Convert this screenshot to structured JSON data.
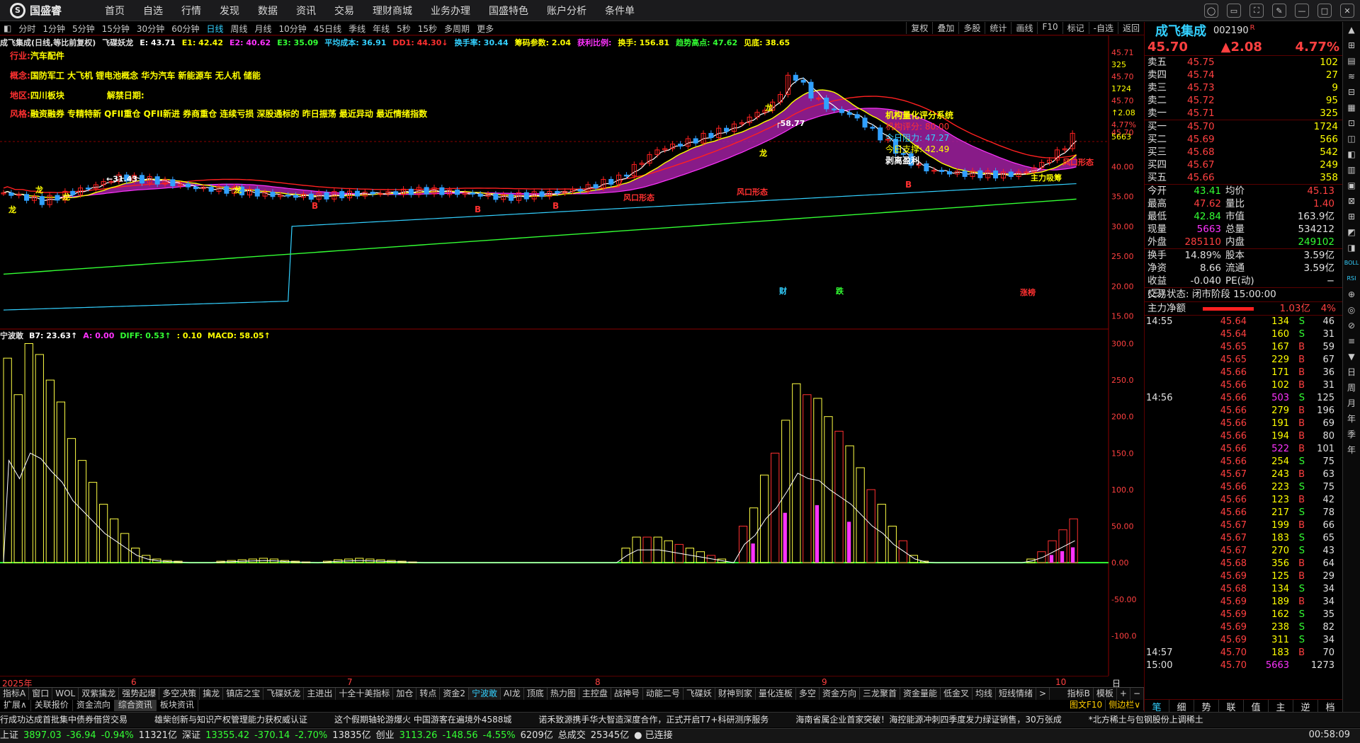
{
  "app": {
    "name": "国盛睿",
    "logo_letter": "S"
  },
  "menu": [
    "首页",
    "自选",
    "行情",
    "发现",
    "数据",
    "资讯",
    "交易",
    "理财商城",
    "业务办理",
    "国盛特色",
    "账户分析",
    "条件单"
  ],
  "window_icons": [
    "◯",
    "▭",
    "⛶",
    "✎",
    "—",
    "□",
    "✕"
  ],
  "period_tabs": [
    "分时",
    "1分钟",
    "5分钟",
    "15分钟",
    "30分钟",
    "60分钟",
    "日线",
    "周线",
    "月线",
    "10分钟",
    "45日线",
    "季线",
    "年线",
    "5秒",
    "15秒",
    "多周期",
    "更多"
  ],
  "period_selected": "日线",
  "chart_tools": [
    "复权",
    "叠加",
    "多股",
    "统计",
    "画线",
    "F10",
    "标记",
    "-自选",
    "返回"
  ],
  "indicator_line": [
    {
      "t": "成飞集成(日线,等比前复权)",
      "c": "#e0e0e0"
    },
    {
      "t": "飞碟妖龙",
      "c": "#e0e0e0"
    },
    {
      "t": "E: 43.71",
      "c": "#ffffff"
    },
    {
      "t": "E1: 42.42",
      "c": "#ffff00"
    },
    {
      "t": "E2: 40.62",
      "c": "#ff33ff"
    },
    {
      "t": "E3: 35.09",
      "c": "#33ff33"
    },
    {
      "t": "平均成本: 36.91",
      "c": "#33d0ff"
    },
    {
      "t": "DD1: 44.30↓",
      "c": "#ff3030"
    },
    {
      "t": "换手率: 30.44",
      "c": "#33d0ff"
    },
    {
      "t": "筹码参数: 2.04",
      "c": "#ffff00"
    },
    {
      "t": "获利比例:",
      "c": "#ff33ff"
    },
    {
      "t": "换手: 156.81",
      "c": "#ffff00"
    },
    {
      "t": "趋势高点: 47.62",
      "c": "#33ff33"
    },
    {
      "t": "见底: 38.65",
      "c": "#ffff00"
    }
  ],
  "info": {
    "industry_k": "行业:",
    "industry_v": "汽车配件",
    "concept_k": "概念:",
    "concept_v": "国防军工 大飞机 锂电池概念 华为汽车 新能源车 无人机 储能",
    "region_k": "地区:",
    "region_v": "四川板块",
    "unlock_k": "解禁日期:",
    "style_k": "风格:",
    "style_v": "融资融券 专精特新 QFII重仓 QFII新进 券商重仓 连续亏损 深股通标的 昨日振荡 最近异动 最近情绪指数"
  },
  "inst_panel": {
    "title": "机构量化评分系统",
    "score": "机构评分:  80.00",
    "resist": "今日阻力:  47.27",
    "support": "今日支撑:  42.49",
    "note": "剥离盈利"
  },
  "sub_indicator": [
    {
      "t": "宁波敢",
      "c": "#e0e0e0"
    },
    {
      "t": "B7: 23.63↑",
      "c": "#ffffff"
    },
    {
      "t": "A: 0.00",
      "c": "#ff33ff"
    },
    {
      "t": "DIFF: 0.53↑",
      "c": "#33ff33"
    },
    {
      "t": ": 0.10",
      "c": "#ffff00"
    },
    {
      "t": "MACD: 58.05↑",
      "c": "#ffff00"
    }
  ],
  "dates": [
    {
      "t": "2025年",
      "x": 3
    },
    {
      "t": "6",
      "x": 185
    },
    {
      "t": "7",
      "x": 490
    },
    {
      "t": "8",
      "x": 840
    },
    {
      "t": "9",
      "x": 1160
    },
    {
      "t": "10",
      "x": 1490
    }
  ],
  "date_right": "日线",
  "indicator_tabs": [
    "指标A",
    "窗口",
    "WOL",
    "双紫擒龙",
    "强势起爆",
    "多空决策",
    "擒龙",
    "镇店之宝",
    "飞碟妖龙",
    "主进出",
    "十全十美指标",
    "加仓",
    "转点",
    "资金2",
    "宁波敢",
    "AI龙",
    "顶底",
    "热力图",
    "主控盘",
    "战神号",
    "动能二号",
    "飞碟妖",
    "财神到家",
    "量化连板",
    "多空",
    "资金方向",
    "三龙聚首",
    "资金量能",
    "低金叉",
    "均线",
    "短线情绪"
  ],
  "indicator_tab_selected": "宁波敢",
  "indicator_tab_tail": [
    "指标B",
    "模板",
    "+",
    "−"
  ],
  "bottom_tabs": [
    "扩展∧",
    "关联报价",
    "资金流向",
    "综合资讯",
    "板块资讯"
  ],
  "bottom_tab_selected": "综合资讯",
  "f10_links": [
    "图文F10",
    "侧边栏∨"
  ],
  "ticker": [
    "行成功达成首批集中债券借贷交易",
    "雄柴创新与知识产权管理能力获权威认证",
    "这个假期轴轮游爆火 中国游客在遍境外4588城",
    "诺禾致源携手华大智造深度合作，正式开启T7+科研测序服务",
    "海南省属企业首家突破！海控能源冲刺四季度发力绿证销售，30万张成",
    "*北方稀土与包钢股份上调稀土"
  ],
  "status": [
    {
      "t": "上证",
      "c": "#e0e0e0"
    },
    {
      "t": "3897.03",
      "c": "#33ff33"
    },
    {
      "t": "-36.94",
      "c": "#33ff33"
    },
    {
      "t": "-0.94%",
      "c": "#33ff33"
    },
    {
      "t": "11321亿",
      "c": "#e0e0e0"
    },
    {
      "t": "深证",
      "c": "#e0e0e0"
    },
    {
      "t": "13355.42",
      "c": "#33ff33"
    },
    {
      "t": "-370.14",
      "c": "#33ff33"
    },
    {
      "t": "-2.70%",
      "c": "#33ff33"
    },
    {
      "t": "13835亿",
      "c": "#e0e0e0"
    },
    {
      "t": "创业",
      "c": "#e0e0e0"
    },
    {
      "t": "3113.26",
      "c": "#33ff33"
    },
    {
      "t": "-148.56",
      "c": "#33ff33"
    },
    {
      "t": "-4.55%",
      "c": "#33ff33"
    },
    {
      "t": "6209亿",
      "c": "#e0e0e0"
    },
    {
      "t": "总成交",
      "c": "#e0e0e0"
    },
    {
      "t": "25345亿",
      "c": "#e0e0e0"
    },
    {
      "t": "● 已连接",
      "c": "#e0e0e0"
    }
  ],
  "status_time": "00:58:09",
  "stock": {
    "name": "成飞集成",
    "code": "002190",
    "flag": "R",
    "price": "45.70",
    "change": "▲2.08",
    "pct": "4.77%"
  },
  "asks": [
    {
      "n": "卖五",
      "p": "45.75",
      "v": "102"
    },
    {
      "n": "卖四",
      "p": "45.74",
      "v": "27"
    },
    {
      "n": "卖三",
      "p": "45.73",
      "v": "9"
    },
    {
      "n": "卖二",
      "p": "45.72",
      "v": "95"
    },
    {
      "n": "卖一",
      "p": "45.71",
      "v": "325"
    }
  ],
  "bids": [
    {
      "n": "买一",
      "p": "45.70",
      "v": "1724"
    },
    {
      "n": "买二",
      "p": "45.69",
      "v": "566"
    },
    {
      "n": "买三",
      "p": "45.68",
      "v": "542"
    },
    {
      "n": "买四",
      "p": "45.67",
      "v": "249"
    },
    {
      "n": "买五",
      "p": "45.66",
      "v": "358"
    }
  ],
  "stats": [
    {
      "a": "今开",
      "b": "43.41",
      "bc": "#33ff33",
      "c": "均价",
      "d": "45.13",
      "dc": "#ff4040"
    },
    {
      "a": "最高",
      "b": "47.62",
      "bc": "#ff4040",
      "c": "量比",
      "d": "1.40",
      "dc": "#ff4040"
    },
    {
      "a": "最低",
      "b": "42.84",
      "bc": "#33ff33",
      "c": "市值",
      "d": "163.9亿",
      "dc": "#e0e0e0"
    },
    {
      "a": "现量",
      "b": "5663",
      "bc": "#ff33ff",
      "c": "总量",
      "d": "534212",
      "dc": "#e0e0e0"
    },
    {
      "a": "外盘",
      "b": "285110",
      "bc": "#ff4040",
      "c": "内盘",
      "d": "249102",
      "dc": "#33ff33"
    }
  ],
  "stats2": [
    {
      "a": "换手",
      "b": "14.89%",
      "bc": "#e0e0e0",
      "c": "股本",
      "d": "3.59亿",
      "dc": "#e0e0e0"
    },
    {
      "a": "净资",
      "b": "8.66",
      "bc": "#e0e0e0",
      "c": "流通",
      "d": "3.59亿",
      "dc": "#e0e0e0"
    },
    {
      "a": "收益(三)",
      "b": "-0.040",
      "bc": "#e0e0e0",
      "c": "PE(动)",
      "d": "−",
      "dc": "#e0e0e0"
    }
  ],
  "trade_state": "交易状态: 闭市阶段 15:00:00",
  "main_flow": {
    "label": "主力净额",
    "value": "1.03亿",
    "pct": "4%"
  },
  "ticks": [
    {
      "t": "14:55",
      "p": "45.64",
      "v": "134",
      "bs": "S",
      "c": "46"
    },
    {
      "t": "",
      "p": "45.64",
      "v": "160",
      "bs": "S",
      "c": "31"
    },
    {
      "t": "",
      "p": "45.65",
      "v": "167",
      "bs": "B",
      "c": "59"
    },
    {
      "t": "",
      "p": "45.65",
      "v": "229",
      "bs": "B",
      "c": "67"
    },
    {
      "t": "",
      "p": "45.66",
      "v": "171",
      "bs": "B",
      "c": "36"
    },
    {
      "t": "",
      "p": "45.66",
      "v": "102",
      "bs": "B",
      "c": "31"
    },
    {
      "t": "14:56",
      "p": "45.66",
      "v": "503",
      "bs": "S",
      "c": "125"
    },
    {
      "t": "",
      "p": "45.66",
      "v": "279",
      "bs": "B",
      "c": "196"
    },
    {
      "t": "",
      "p": "45.66",
      "v": "191",
      "bs": "B",
      "c": "69"
    },
    {
      "t": "",
      "p": "45.66",
      "v": "194",
      "bs": "B",
      "c": "80"
    },
    {
      "t": "",
      "p": "45.66",
      "v": "522",
      "bs": "B",
      "c": "101"
    },
    {
      "t": "",
      "p": "45.66",
      "v": "254",
      "bs": "S",
      "c": "75"
    },
    {
      "t": "",
      "p": "45.67",
      "v": "243",
      "bs": "B",
      "c": "63"
    },
    {
      "t": "",
      "p": "45.66",
      "v": "223",
      "bs": "S",
      "c": "75"
    },
    {
      "t": "",
      "p": "45.66",
      "v": "123",
      "bs": "B",
      "c": "42"
    },
    {
      "t": "",
      "p": "45.66",
      "v": "217",
      "bs": "S",
      "c": "78"
    },
    {
      "t": "",
      "p": "45.67",
      "v": "199",
      "bs": "B",
      "c": "66"
    },
    {
      "t": "",
      "p": "45.67",
      "v": "183",
      "bs": "S",
      "c": "65"
    },
    {
      "t": "",
      "p": "45.67",
      "v": "270",
      "bs": "S",
      "c": "43"
    },
    {
      "t": "",
      "p": "45.68",
      "v": "356",
      "bs": "B",
      "c": "64"
    },
    {
      "t": "",
      "p": "45.69",
      "v": "125",
      "bs": "B",
      "c": "29"
    },
    {
      "t": "",
      "p": "45.68",
      "v": "134",
      "bs": "S",
      "c": "34"
    },
    {
      "t": "",
      "p": "45.69",
      "v": "189",
      "bs": "B",
      "c": "34"
    },
    {
      "t": "",
      "p": "45.69",
      "v": "162",
      "bs": "S",
      "c": "35"
    },
    {
      "t": "",
      "p": "45.69",
      "v": "238",
      "bs": "S",
      "c": "82"
    },
    {
      "t": "",
      "p": "45.69",
      "v": "311",
      "bs": "S",
      "c": "34"
    },
    {
      "t": "14:57",
      "p": "45.70",
      "v": "183",
      "bs": "B",
      "c": "70"
    },
    {
      "t": "15:00",
      "p": "45.70",
      "v": "5663",
      "bs": "",
      "c": "1273"
    }
  ],
  "side_tabs": [
    "笔",
    "细",
    "势",
    "联",
    "值",
    "主",
    "逆",
    "档"
  ],
  "side_tab_selected": "笔",
  "right_toolbar": [
    "▲",
    "⊞",
    "▤",
    "≋",
    "⊟",
    "▦",
    "⊡",
    "◫",
    "◧",
    "▥",
    "▣",
    "⊠",
    "⊞",
    "◩",
    "◨",
    "BOLL",
    "RSI",
    "⊕",
    "◎",
    "⊘",
    "≡",
    "▼",
    "日",
    "周",
    "月",
    "年",
    "季",
    "年"
  ],
  "chart_data": [
    {
      "type": "candlestick",
      "title": "成飞集成(日线,等比前复权)",
      "y_ticks": [
        "15.00",
        "20.00",
        "25.00",
        "30.00",
        "35.00",
        "40.00",
        "45.70"
      ],
      "right_labels": [
        "45.71",
        "325",
        "45.70",
        "1724",
        "45.70",
        "↑2.08",
        "4.77%",
        "5663"
      ],
      "close_path": [
        [
          0,
          35.6
        ],
        [
          10,
          34.2
        ],
        [
          20,
          36.1
        ],
        [
          30,
          38.2
        ],
        [
          40,
          37.6
        ],
        [
          50,
          36.4
        ],
        [
          60,
          36.0
        ],
        [
          70,
          35.2
        ],
        [
          80,
          35.0
        ],
        [
          90,
          35.4
        ],
        [
          100,
          35.6
        ],
        [
          110,
          36.0
        ],
        [
          120,
          35.5
        ],
        [
          130,
          34.8
        ],
        [
          140,
          35.4
        ],
        [
          150,
          36.2
        ],
        [
          160,
          38.0
        ],
        [
          170,
          42.8
        ],
        [
          180,
          44.5
        ],
        [
          190,
          46.8
        ],
        [
          200,
          50.4
        ],
        [
          205,
          55.8
        ],
        [
          210,
          52.0
        ],
        [
          215,
          49.5
        ],
        [
          220,
          48.8
        ],
        [
          225,
          46.5
        ],
        [
          230,
          44.0
        ],
        [
          235,
          41.0
        ],
        [
          240,
          39.5
        ],
        [
          245,
          39.0
        ],
        [
          250,
          38.8
        ],
        [
          260,
          38.6
        ],
        [
          265,
          38.9
        ],
        [
          270,
          40.5
        ],
        [
          275,
          42.8
        ],
        [
          279,
          45.7
        ]
      ],
      "annotations": [
        "←31.43",
        "58.77",
        "风口形态",
        "主力吸筹",
        "龙",
        "B",
        "财",
        "跌",
        "涨榜"
      ]
    },
    {
      "type": "bar",
      "title": "宁波敢",
      "y_ticks": [
        "300.0",
        "250.0",
        "200.0",
        "150.0",
        "100.0",
        "50.00",
        "0.00",
        "-50.00",
        "-100.0"
      ],
      "series": [
        {
          "name": "B7",
          "values": [
            280,
            230,
            300,
            285,
            250,
            220,
            170,
            140,
            110,
            80,
            60,
            40,
            20,
            10,
            5,
            3,
            2,
            0,
            0,
            0,
            2,
            3,
            4,
            5,
            6,
            5,
            3,
            2,
            1,
            0,
            2,
            4,
            5,
            6,
            5,
            4,
            3,
            2,
            1,
            0,
            0,
            0,
            0,
            0,
            0,
            0,
            0,
            0,
            0,
            0,
            0,
            0,
            0,
            0,
            0,
            0,
            0,
            0,
            20,
            35,
            35,
            35,
            30,
            25,
            20,
            15,
            10,
            5,
            0,
            50,
            75,
            120,
            150,
            195,
            245,
            230,
            225,
            200,
            180,
            160,
            130,
            100,
            80,
            50,
            30,
            10,
            2,
            0,
            0,
            0,
            0,
            0,
            0,
            0,
            0,
            0,
            5,
            15,
            30,
            45,
            60
          ]
        }
      ]
    }
  ]
}
